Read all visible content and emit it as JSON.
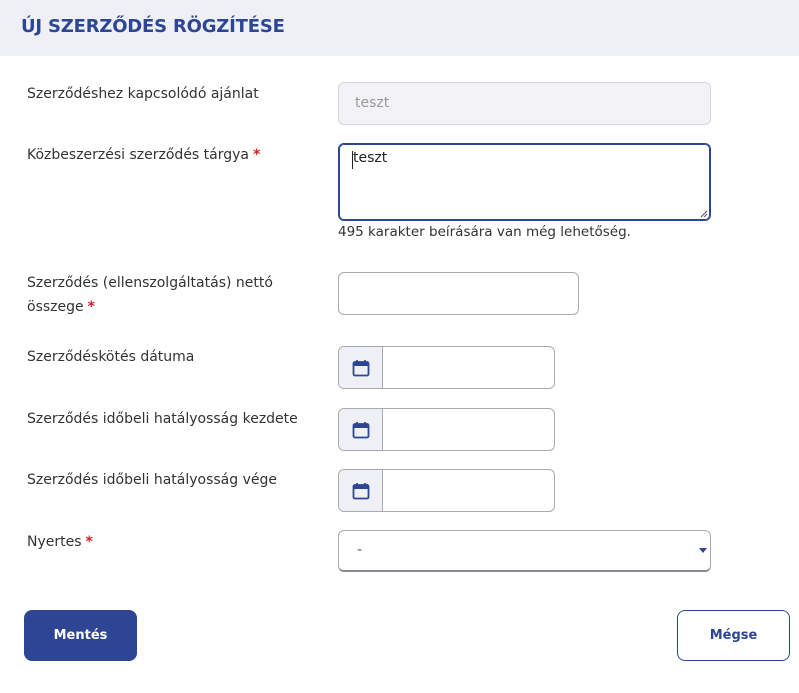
{
  "header": {
    "title": "ÚJ SZERZŐDÉS RÖGZÍTÉSE"
  },
  "form": {
    "offer": {
      "label": "Szerződéshez kapcsolódó ajánlat",
      "value": "teszt"
    },
    "subject": {
      "label": "Közbeszerzési szerződés tárgya",
      "required_mark": "*",
      "value": "teszt",
      "hint": "495 karakter beírására van még lehetőség."
    },
    "amount": {
      "label_line1": "Szerződés (ellenszolgáltatás) nettó",
      "label_line2": "összege",
      "required_mark": "*",
      "value": ""
    },
    "signed_date": {
      "label": "Szerződéskötés dátuma",
      "value": ""
    },
    "valid_from": {
      "label": "Szerződés időbeli hatályosság kezdete",
      "value": ""
    },
    "valid_to": {
      "label": "Szerződés időbeli hatályosság vége",
      "value": ""
    },
    "winner": {
      "label": "Nyertes",
      "required_mark": "*",
      "selected": "-"
    }
  },
  "actions": {
    "save_label": "Mentés",
    "cancel_label": "Mégse"
  },
  "icons": {
    "calendar": "calendar-icon",
    "dropdown": "caret-down-icon",
    "resize": "resize-handle-icon"
  },
  "colors": {
    "brand": "#2d4593",
    "required": "#d0202a",
    "header_bg": "#eef0f5"
  }
}
